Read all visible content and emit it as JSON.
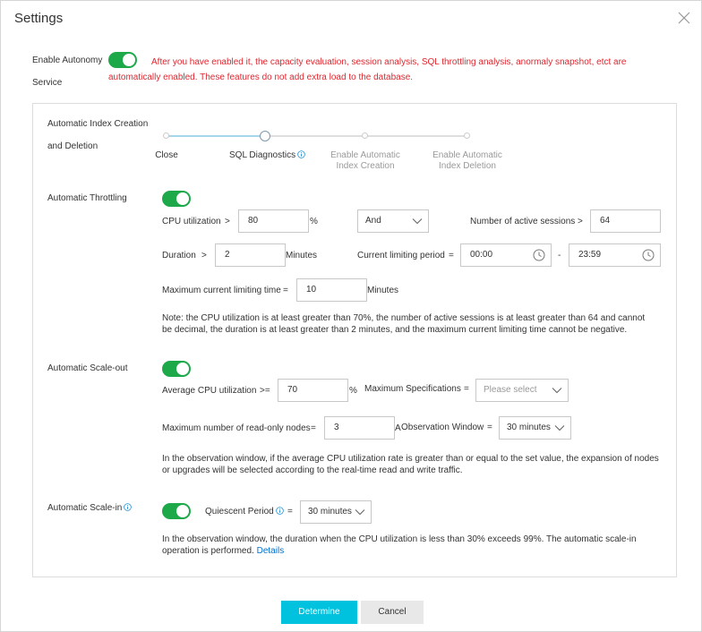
{
  "dialog": {
    "title": "Settings",
    "autonomy_label_1": "Enable Autonomy",
    "autonomy_label_2": "Service",
    "autonomy_warning": "After you have enabled it, the capacity evaluation, session analysis, SQL throttling analysis, anormaly snapshot, etct are automatically enabled. These features do not add extra load to the database.",
    "autonomy_enabled": true
  },
  "index": {
    "label_1": "Automatic Index Creation",
    "label_2": "and Deletion",
    "steps": [
      "Close",
      "SQL Diagnostics",
      "Enable Automatic",
      "Index Creation",
      "Enable Automatic",
      "Index Deletion"
    ],
    "selected_step": "SQL Diagnostics"
  },
  "throttling": {
    "label": "Automatic Throttling",
    "enabled": true,
    "cpu_label": "CPU utilization",
    "gt": ">",
    "gte": ">=",
    "eq": "=",
    "dash": "-",
    "cpu_value": "80",
    "percent": "%",
    "logic_value": "And",
    "sessions_label": "Number of active sessions",
    "sessions_value": "64",
    "duration_label": "Duration",
    "duration_value": "2",
    "minutes": "Minutes",
    "period_label": "Current limiting period",
    "period_start": "00:00",
    "period_end": "23:59",
    "max_time_label": "Maximum current limiting time",
    "max_time_value": "10",
    "note": "Note: the CPU utilization is at least greater than 70%, the number of active sessions is at least greater than 64 and cannot be decimal, the duration is at least greater than 2 minutes, and the maximum current limiting time cannot be negative."
  },
  "scale_out": {
    "label": "Automatic Scale-out",
    "enabled": true,
    "avg_cpu_label": "Average CPU utilization",
    "avg_cpu_value": "70",
    "max_spec_label": "Maximum Specifications",
    "max_spec_placeholder": "Please select",
    "max_nodes_label": "Maximum number of read-only nodes",
    "max_nodes_value": "3",
    "max_nodes_suffix": "A",
    "obs_window_label": "Observation Window",
    "obs_window_value": "30 minutes",
    "note": "In the observation window, if the average CPU utilization rate is greater than or equal to the set value, the expansion of nodes or upgrades will be selected according to the real-time read and write traffic."
  },
  "scale_in": {
    "label": "Automatic Scale-in",
    "enabled": true,
    "quiescent_label": "Quiescent Period",
    "quiescent_value": "30 minutes",
    "note": "In the observation window, the duration when the CPU utilization is less than 30% exceeds 99%. The automatic scale-in operation is performed.",
    "details_link": "Details"
  },
  "footer": {
    "determine_label": "Determine",
    "cancel_label": "Cancel"
  },
  "colors": {
    "toggle_on": "#1da84a",
    "primary": "#00c1de",
    "warning": "#e0262e",
    "link": "#0070cc"
  }
}
